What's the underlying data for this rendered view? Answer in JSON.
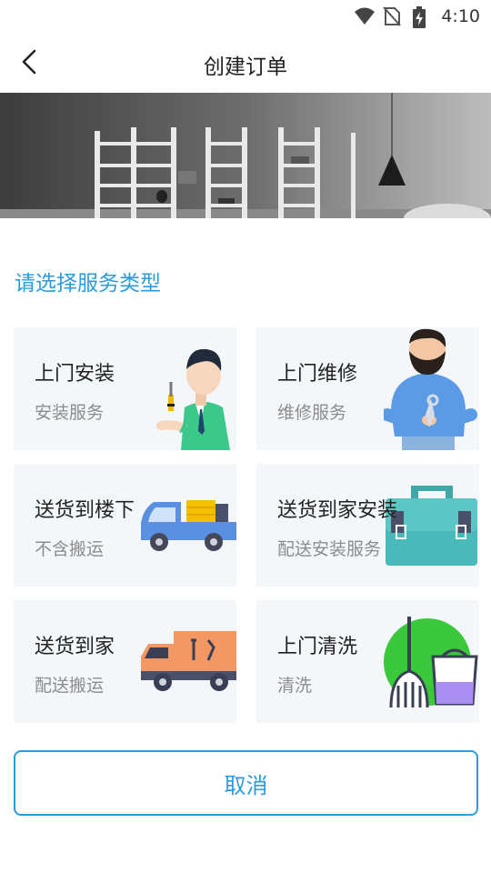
{
  "status_bar": {
    "time": "4:10",
    "icons": [
      "wifi-icon",
      "no-sim-icon",
      "battery-charging-icon"
    ]
  },
  "nav": {
    "title": "创建订单",
    "back_icon": "chevron-left-icon"
  },
  "banner": {
    "image": "interior-shelves-photo"
  },
  "section": {
    "title": "请选择服务类型"
  },
  "services": [
    {
      "title": "上门安装",
      "subtitle": "安装服务",
      "icon": "installer-man-with-screwdriver"
    },
    {
      "title": "上门维修",
      "subtitle": "维修服务",
      "icon": "bearded-repairman-with-wrench"
    },
    {
      "title": "送货到楼下",
      "subtitle": "不含搬运",
      "icon": "pickup-truck-with-boxes"
    },
    {
      "title": "送货到家安装",
      "subtitle": "配送安装服务",
      "icon": "toolbox-icon"
    },
    {
      "title": "送货到家",
      "subtitle": "配送搬运",
      "icon": "delivery-truck-with-tools"
    },
    {
      "title": "上门清洗",
      "subtitle": "清洗",
      "icon": "broom-and-bucket"
    }
  ],
  "colors": {
    "accent": "#2b9bdc",
    "card_bg": "#f4f7fa",
    "subtitle": "#8c8c8c"
  },
  "footer": {
    "cancel_label": "取消"
  }
}
